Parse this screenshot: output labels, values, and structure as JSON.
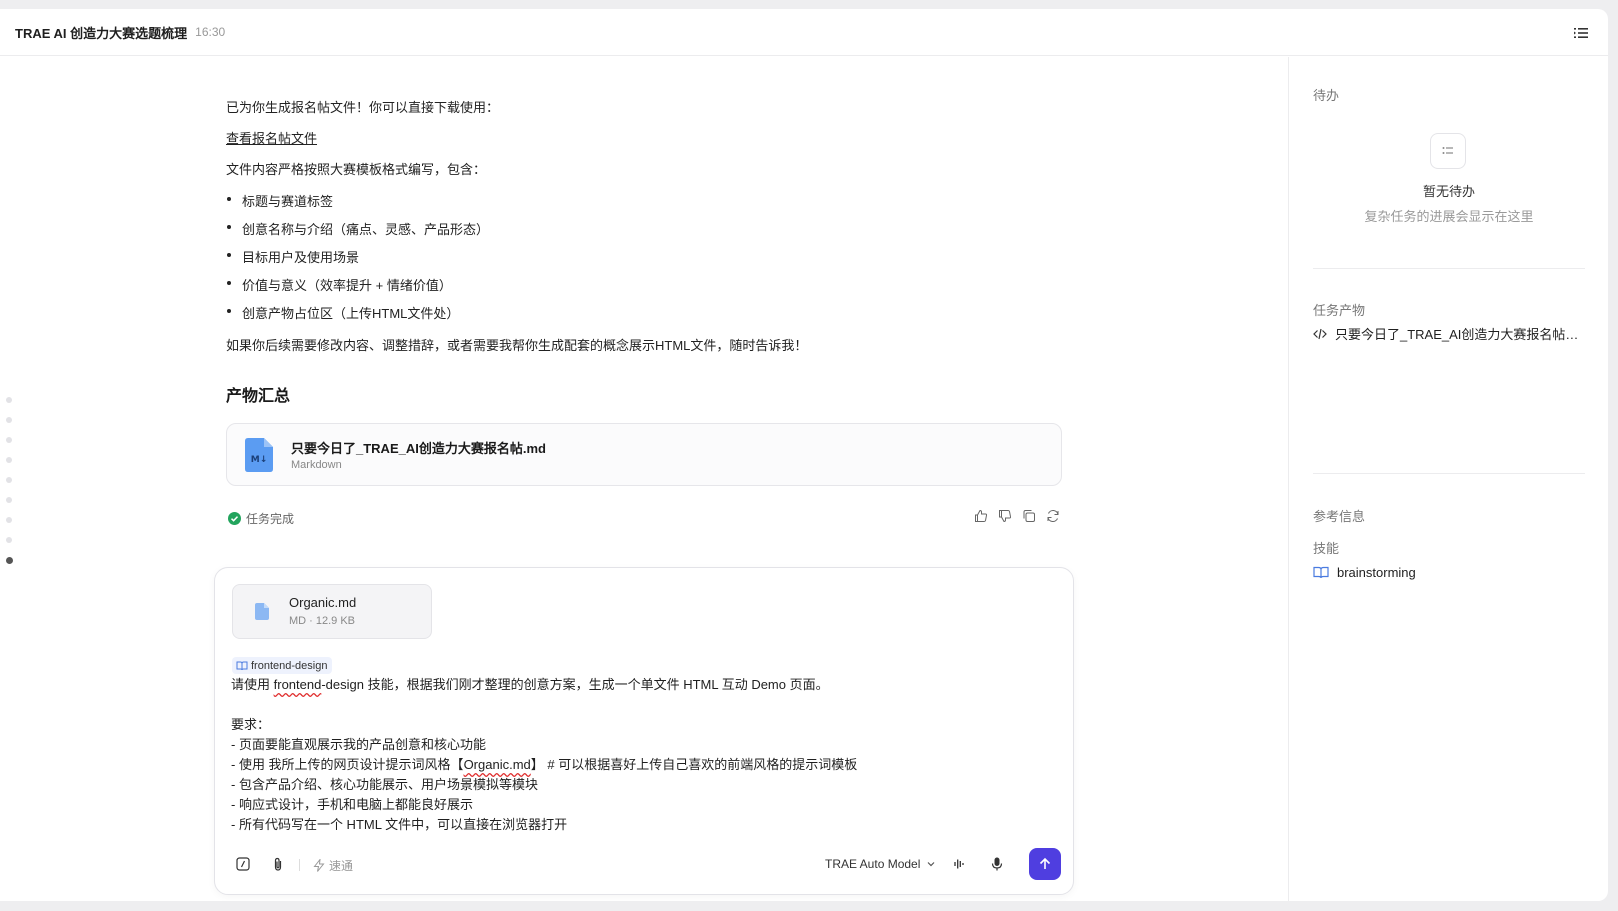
{
  "window": {
    "title": "TRAE AI 创造力大赛选题梳理",
    "time": "16:30"
  },
  "message": {
    "p1": "已为你生成报名帖文件！你可以直接下载使用：",
    "link": "查看报名帖文件",
    "p2": "文件内容严格按照大赛模板格式编写，包含：",
    "bullets": [
      "标题与赛道标签",
      "创意名称与介绍（痛点、灵感、产品形态）",
      "目标用户及使用场景",
      "价值与意义（效率提升 + 情绪价值）",
      "创意产物占位区（上传HTML文件处）"
    ],
    "p3": "如果你后续需要修改内容、调整措辞，或者需要我帮你生成配套的概念展示HTML文件，随时告诉我！",
    "section_title": "产物汇总",
    "file": {
      "name": "只要今日了_TRAE_AI创造力大赛报名帖.md",
      "type": "Markdown",
      "icon_text": "M↓"
    },
    "status": "任务完成"
  },
  "composer": {
    "attachment": {
      "name": "Organic.md",
      "meta": "MD · 12.9 KB"
    },
    "skill_chip": "frontend-design",
    "line1_a": "请使用 ",
    "line1_b": "frontend",
    "line1_c": "-design 技能，根据我们刚才整理的创意方案，生成一个单文件 HTML 互动 Demo 页面。",
    "line2": "要求：",
    "line3": "- 页面要能直观展示我的产品创意和核心功能",
    "line4_a": "- 使用 我所上传的网页设计提示词风格【",
    "line4_b": "Organic.md",
    "line4_c": "】 # 可以根据喜好上传自己喜欢的前端风格的提示词模板",
    "line5": "- 包含产品介绍、核心功能展示、用户场景模拟等模块",
    "line6": "- 响应式设计，手机和电脑上都能良好展示",
    "line7": "- 所有代码写在一个 HTML 文件中，可以直接在浏览器打开",
    "speed_label": "速通",
    "model_label": "TRAE Auto Model"
  },
  "side": {
    "todo_label": "待办",
    "empty_title": "暂无待办",
    "empty_sub": "复杂任务的进展会显示在这里",
    "artifacts_label": "任务产物",
    "artifact_item": "只要今日了_TRAE_AI创造力大赛报名帖.md",
    "ref_label": "参考信息",
    "skills_label": "技能",
    "skill_item": "brainstorming"
  },
  "colors": {
    "accent": "#4f3ee0",
    "success": "#22a45d",
    "md_icon": "#5b9cf2"
  }
}
